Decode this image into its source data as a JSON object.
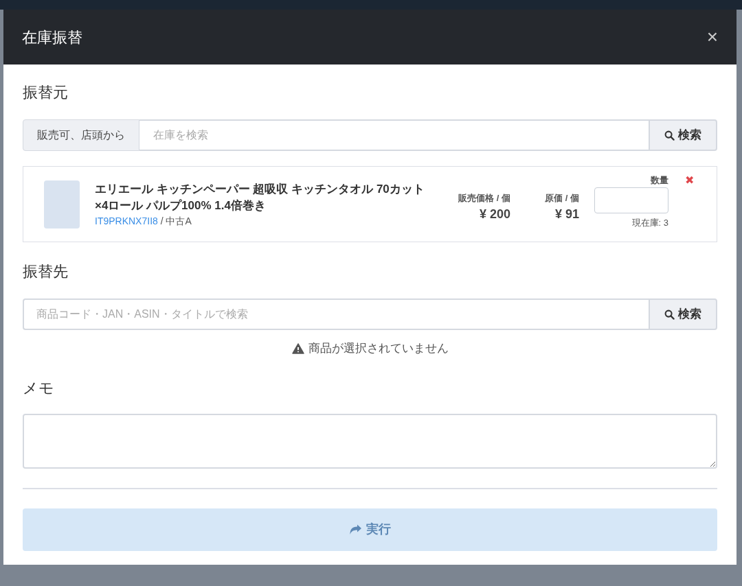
{
  "modal": {
    "title": "在庫振替",
    "close": "×"
  },
  "source": {
    "heading": "振替元",
    "filter": "販売可、店頭から",
    "search": {
      "placeholder": "在庫を検索"
    },
    "search_button": "検索"
  },
  "items": [
    {
      "title": "エリエール キッチンペーパー 超吸収 キッチンタオル 70カット×4ロール パルプ100% 1.4倍巻き",
      "code": "IT9PRKNX7II8",
      "condition": "/ 中古A",
      "price_label": "販売価格 / 個",
      "price": "¥ 200",
      "cost_label": "原価 / 個",
      "cost": "¥ 91",
      "qty_label": "数量",
      "stock": "現在庫: 3",
      "remove": "✖"
    }
  ],
  "destination": {
    "heading": "振替先",
    "search": {
      "placeholder": "商品コード・JAN・ASIN・タイトルで検索"
    },
    "search_button": "検索",
    "warning": "商品が選択されていません"
  },
  "memo": {
    "heading": "メモ"
  },
  "submit": {
    "label": "実行",
    "disabled": true
  }
}
